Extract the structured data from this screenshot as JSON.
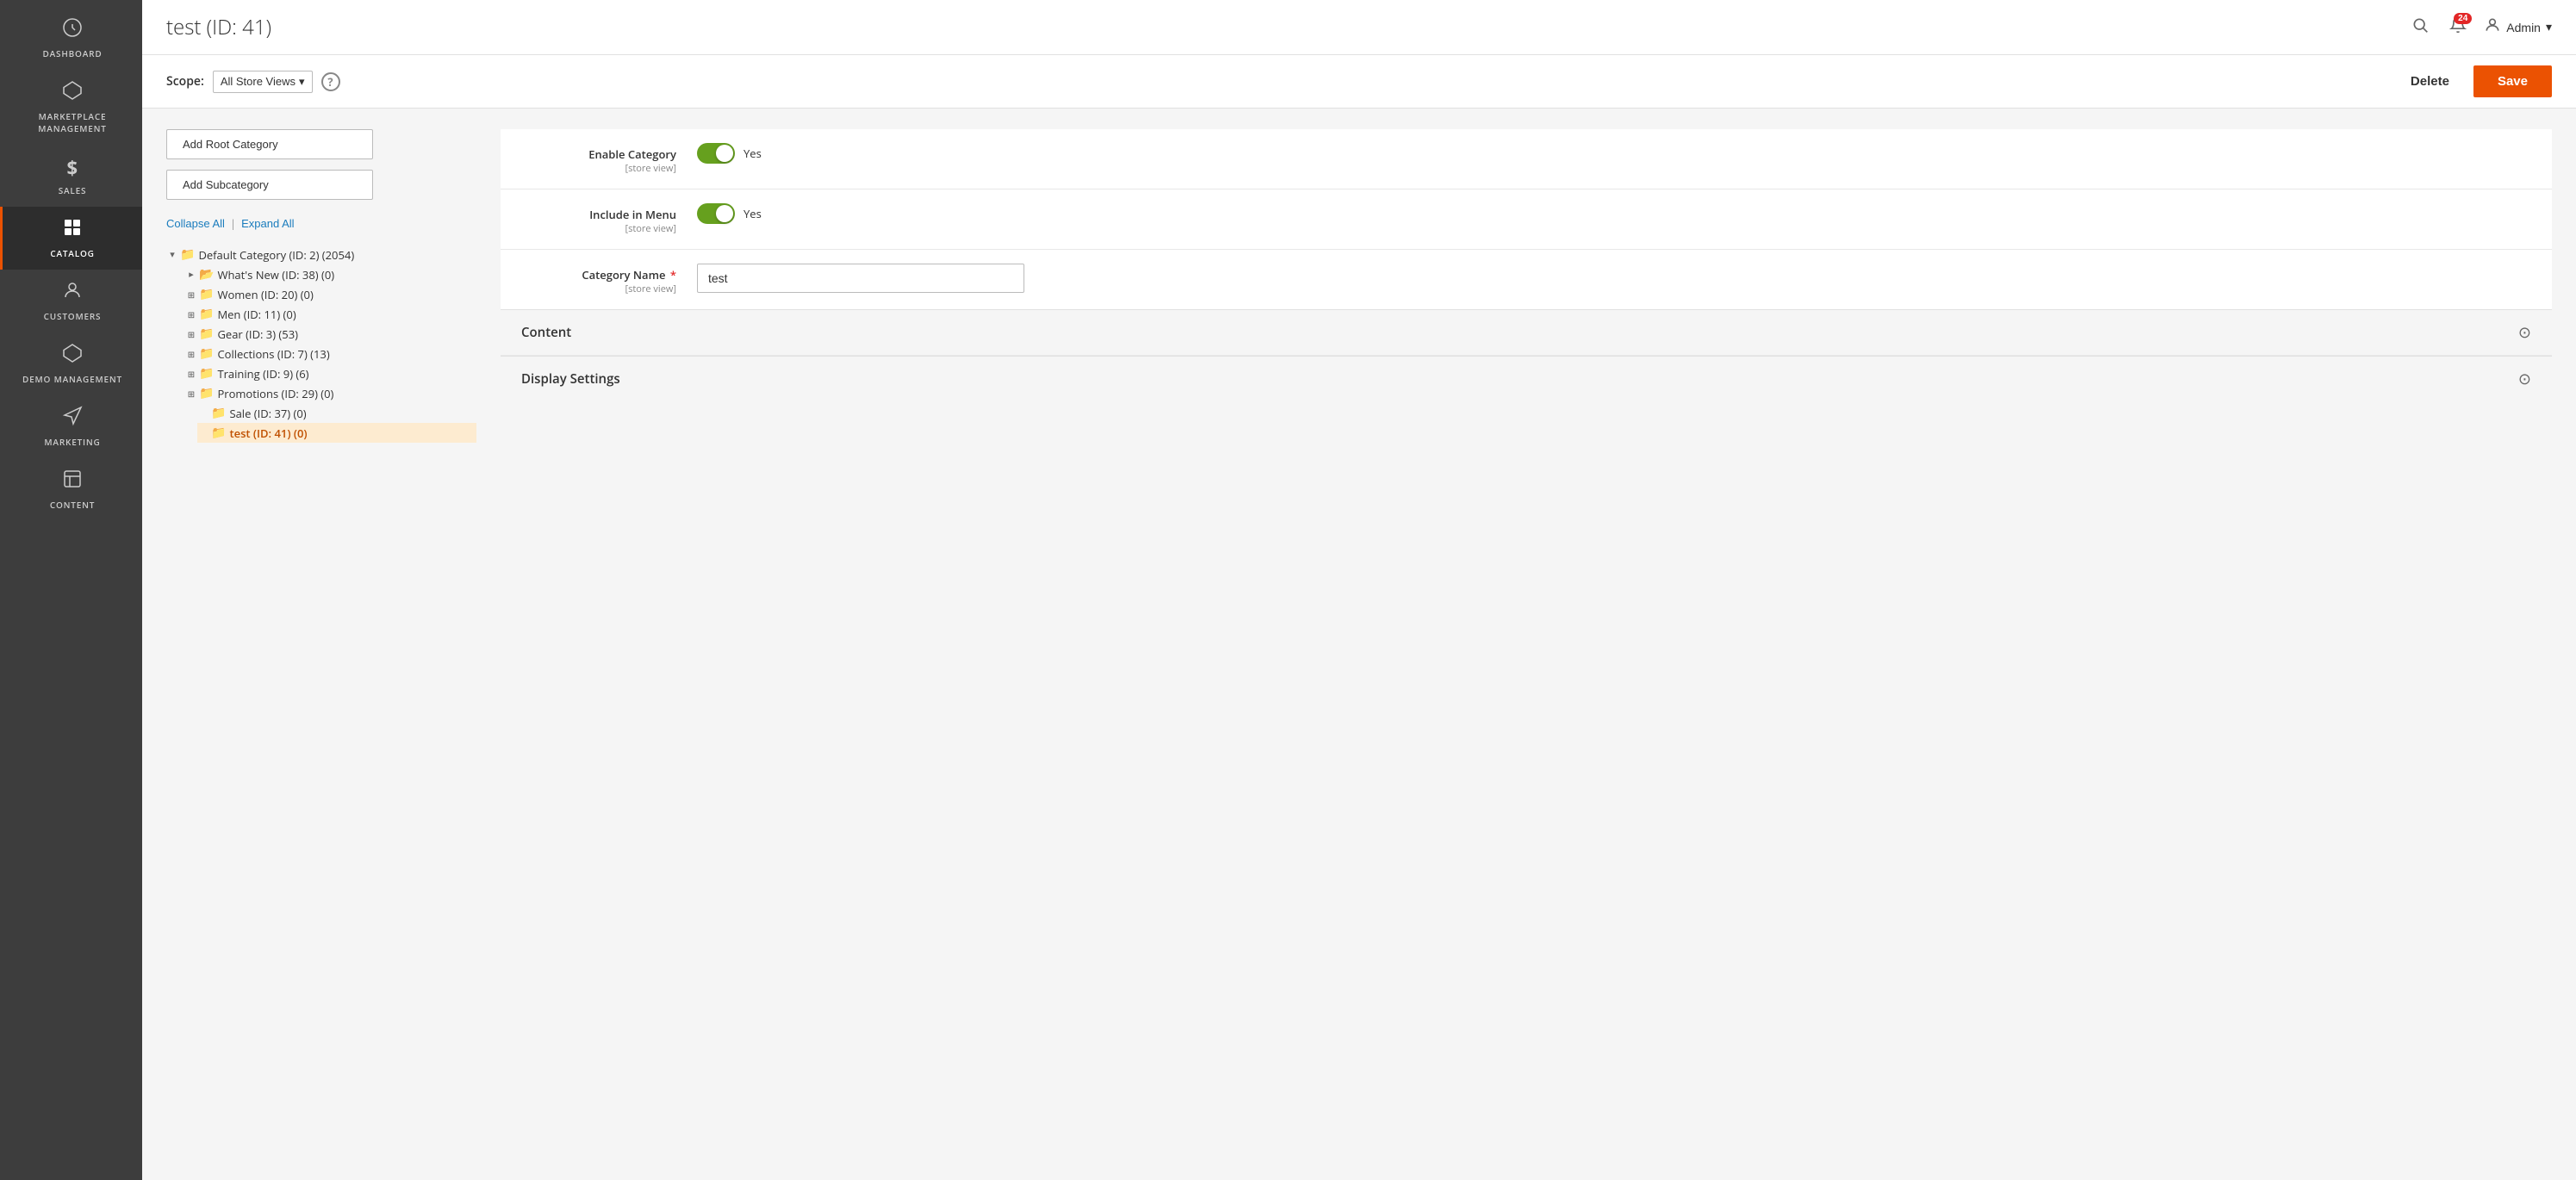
{
  "app": {
    "title": "test (ID: 41)"
  },
  "topbar": {
    "title": "test (ID: 41)",
    "notification_count": "24",
    "user_label": "Admin"
  },
  "scope": {
    "label": "Scope:",
    "store_view": "All Store Views",
    "help": "?",
    "delete_label": "Delete",
    "save_label": "Save"
  },
  "sidebar": {
    "items": [
      {
        "id": "dashboard",
        "icon": "⊙",
        "label": "DASHBOARD",
        "active": false
      },
      {
        "id": "marketplace",
        "icon": "⬡",
        "label": "MARKETPLACE MANAGEMENT",
        "active": false
      },
      {
        "id": "sales",
        "icon": "$",
        "label": "SALES",
        "active": false
      },
      {
        "id": "catalog",
        "icon": "📦",
        "label": "CATALOG",
        "active": true
      },
      {
        "id": "customers",
        "icon": "👤",
        "label": "CUSTOMERS",
        "active": false
      },
      {
        "id": "demo-management",
        "icon": "⬡",
        "label": "DEMO MANAGEMENT",
        "active": false
      },
      {
        "id": "marketing",
        "icon": "📢",
        "label": "MARKETING",
        "active": false
      },
      {
        "id": "content",
        "icon": "▦",
        "label": "CONTENT",
        "active": false
      }
    ]
  },
  "buttons": {
    "add_root": "Add Root Category",
    "add_sub": "Add Subcategory",
    "collapse_all": "Collapse All",
    "expand_all": "Expand All"
  },
  "tree": {
    "items": [
      {
        "id": "default",
        "label": "Default Category (ID: 2) (2054)",
        "level": 0,
        "toggle": "▾",
        "selected": false
      },
      {
        "id": "whatsnew",
        "label": "What's New (ID: 38) (0)",
        "level": 1,
        "toggle": "▸",
        "selected": false
      },
      {
        "id": "women",
        "label": "Women (ID: 20) (0)",
        "level": 1,
        "toggle": "⊞",
        "selected": false
      },
      {
        "id": "men",
        "label": "Men (ID: 11) (0)",
        "level": 1,
        "toggle": "⊞",
        "selected": false
      },
      {
        "id": "gear",
        "label": "Gear (ID: 3) (53)",
        "level": 1,
        "toggle": "⊞",
        "selected": false
      },
      {
        "id": "collections",
        "label": "Collections (ID: 7) (13)",
        "level": 1,
        "toggle": "⊞",
        "selected": false
      },
      {
        "id": "training",
        "label": "Training (ID: 9) (6)",
        "level": 1,
        "toggle": "⊞",
        "selected": false
      },
      {
        "id": "promotions",
        "label": "Promotions (ID: 29) (0)",
        "level": 1,
        "toggle": "⊞",
        "selected": false
      },
      {
        "id": "sale",
        "label": "Sale (ID: 37) (0)",
        "level": 2,
        "toggle": "",
        "selected": false
      },
      {
        "id": "test",
        "label": "test (ID: 41) (0)",
        "level": 2,
        "toggle": "",
        "selected": true
      }
    ]
  },
  "form": {
    "enable_category": {
      "label": "Enable Category",
      "sublabel": "[store view]",
      "value": true,
      "yes_label": "Yes"
    },
    "include_menu": {
      "label": "Include in Menu",
      "sublabel": "[store view]",
      "value": true,
      "yes_label": "Yes"
    },
    "category_name": {
      "label": "Category Name",
      "required_star": "*",
      "sublabel": "[store view]",
      "value": "test"
    }
  },
  "sections": [
    {
      "id": "content",
      "label": "Content"
    },
    {
      "id": "display-settings",
      "label": "Display Settings"
    }
  ]
}
